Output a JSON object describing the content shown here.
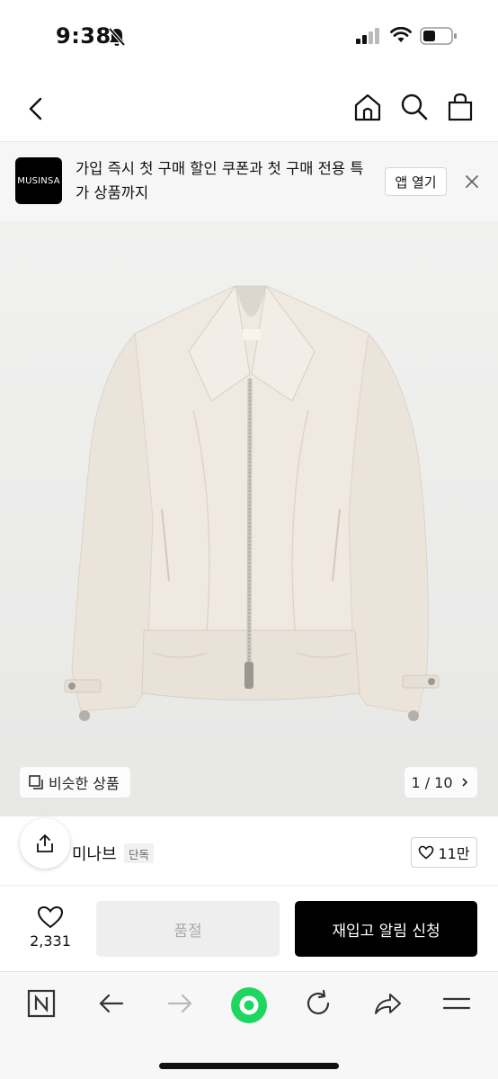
{
  "status_bar": {
    "time": "9:38"
  },
  "nav": {},
  "app_banner": {
    "logo_text": "MUSINSA",
    "message": "가입 즉시 첫 구매 할인 쿠폰과 첫 구매 전용 특가 상품까지",
    "open_label": "앱 열기"
  },
  "product_image": {
    "similar_label": "비슷한 상품",
    "counter": "1 / 10"
  },
  "brand": {
    "name": "미나브",
    "tag": "단독",
    "likes": "11만"
  },
  "actions": {
    "wish_count": "2,331",
    "soldout_label": "품절",
    "restock_label": "재입고 알림 신청"
  },
  "colors": {
    "accent_green": "#1ed760",
    "primary_button": "#000000",
    "disabled_button": "#eeeeee"
  }
}
